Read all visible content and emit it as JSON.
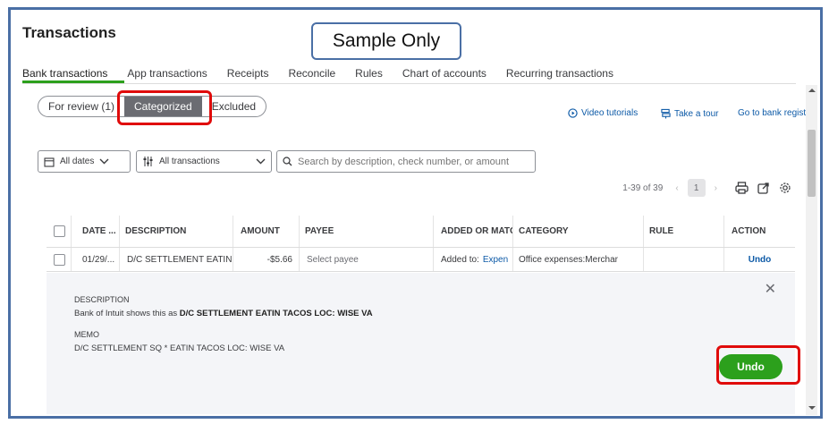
{
  "page": {
    "title": "Transactions",
    "sample_label": "Sample Only"
  },
  "tabs": [
    {
      "label": "Bank transactions"
    },
    {
      "label": "App transactions"
    },
    {
      "label": "Receipts"
    },
    {
      "label": "Reconcile"
    },
    {
      "label": "Rules"
    },
    {
      "label": "Chart of accounts"
    },
    {
      "label": "Recurring transactions"
    }
  ],
  "filter_tabs": {
    "review": "For review (1)",
    "categorized": "Categorized",
    "excluded": "Excluded"
  },
  "links": {
    "video": "Video tutorials",
    "tour": "Take a tour",
    "register": "Go to bank register"
  },
  "filters": {
    "dates": "All dates",
    "transactions": "All transactions",
    "search_placeholder": "Search by description, check number, or amount"
  },
  "pager": {
    "range": "1-39 of 39",
    "page": "1"
  },
  "table": {
    "headers": {
      "date": "DATE ...",
      "description": "DESCRIPTION",
      "amount": "AMOUNT",
      "payee": "PAYEE",
      "added": "ADDED OR MATC",
      "category": "CATEGORY",
      "rule": "RULE",
      "action": "ACTION"
    },
    "row": {
      "date": "01/29/...",
      "description": "D/C SETTLEMENT EATIN T",
      "amount": "-$5.66",
      "payee": "Select payee",
      "added_prefix": "Added to:",
      "added_link": "Expen",
      "category": "Office expenses:Merchar",
      "rule": "",
      "action": "Undo"
    }
  },
  "detail": {
    "description_label": "DESCRIPTION",
    "description_prefix": "Bank of Intuit shows this as ",
    "description_value": "D/C SETTLEMENT EATIN TACOS LOC: WISE VA",
    "memo_label": "MEMO",
    "memo_value": "D/C SETTLEMENT SQ * EATIN TACOS LOC: WISE VA",
    "undo_label": "Undo"
  },
  "colors": {
    "accent": "#2ca01c",
    "link": "#0d5aa7",
    "highlight": "#e00b0b",
    "frame": "#4a6fa5"
  }
}
